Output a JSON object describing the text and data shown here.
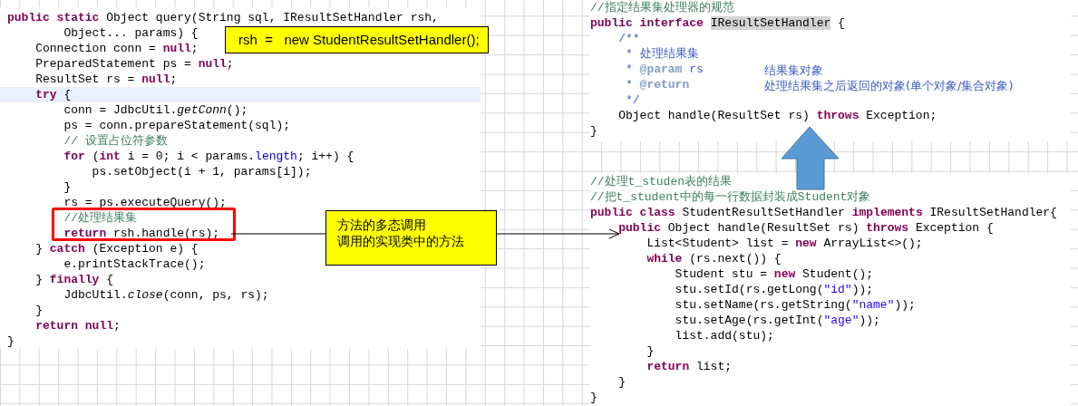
{
  "code_panels": [
    {
      "lines": [
        {
          "current": false,
          "tokens": [
            {
              "kind": "kw",
              "text": "public static"
            },
            {
              "kind": "plain",
              "text": " Object query(String sql, IResultSetHandler rsh,"
            }
          ]
        },
        {
          "current": false,
          "tokens": [
            {
              "kind": "plain",
              "text": "        Object... params) {"
            }
          ]
        },
        {
          "current": false,
          "tokens": [
            {
              "kind": "plain",
              "text": "    Connection conn = "
            },
            {
              "kind": "kw",
              "text": "null"
            },
            {
              "kind": "plain",
              "text": ";"
            }
          ]
        },
        {
          "current": false,
          "tokens": [
            {
              "kind": "plain",
              "text": "    PreparedStatement ps = "
            },
            {
              "kind": "kw",
              "text": "null"
            },
            {
              "kind": "plain",
              "text": ";"
            }
          ]
        },
        {
          "current": false,
          "tokens": [
            {
              "kind": "plain",
              "text": "    ResultSet rs = "
            },
            {
              "kind": "kw",
              "text": "null"
            },
            {
              "kind": "plain",
              "text": ";"
            }
          ]
        },
        {
          "current": true,
          "tokens": [
            {
              "kind": "kw",
              "text": "    try"
            },
            {
              "kind": "plain",
              "text": " {"
            }
          ]
        },
        {
          "current": false,
          "tokens": [
            {
              "kind": "plain",
              "text": "        conn = JdbcUtil."
            },
            {
              "kind": "ital",
              "text": "getConn"
            },
            {
              "kind": "plain",
              "text": "();"
            }
          ]
        },
        {
          "current": false,
          "tokens": [
            {
              "kind": "plain",
              "text": "        ps = conn.prepareStatement(sql);"
            }
          ]
        },
        {
          "current": false,
          "tokens": [
            {
              "kind": "cmt",
              "text": "        // 设置占位符参数"
            }
          ]
        },
        {
          "current": false,
          "tokens": [
            {
              "kind": "kw",
              "text": "        for"
            },
            {
              "kind": "plain",
              "text": " ("
            },
            {
              "kind": "kw",
              "text": "int"
            },
            {
              "kind": "plain",
              "text": " i = 0; i < params."
            },
            {
              "kind": "field",
              "text": "length"
            },
            {
              "kind": "plain",
              "text": "; i++) {"
            }
          ]
        },
        {
          "current": false,
          "tokens": [
            {
              "kind": "plain",
              "text": "            ps.setObject(i + 1, params[i]);"
            }
          ]
        },
        {
          "current": false,
          "tokens": [
            {
              "kind": "plain",
              "text": "        }"
            }
          ]
        },
        {
          "current": false,
          "tokens": [
            {
              "kind": "plain",
              "text": "        rs = ps.executeQuery();"
            }
          ]
        },
        {
          "current": false,
          "tokens": [
            {
              "kind": "cmt",
              "text": "        //处理结果集"
            }
          ]
        },
        {
          "current": false,
          "tokens": [
            {
              "kind": "kw",
              "text": "        return"
            },
            {
              "kind": "plain",
              "text": " rsh.handle(rs);"
            }
          ]
        },
        {
          "current": false,
          "tokens": [
            {
              "kind": "plain",
              "text": "    } "
            },
            {
              "kind": "kw",
              "text": "catch"
            },
            {
              "kind": "plain",
              "text": " (Exception e) {"
            }
          ]
        },
        {
          "current": false,
          "tokens": [
            {
              "kind": "plain",
              "text": "        e.printStackTrace();"
            }
          ]
        },
        {
          "current": false,
          "tokens": [
            {
              "kind": "plain",
              "text": "    } "
            },
            {
              "kind": "kw",
              "text": "finally"
            },
            {
              "kind": "plain",
              "text": " {"
            }
          ]
        },
        {
          "current": false,
          "tokens": [
            {
              "kind": "plain",
              "text": "        JdbcUtil."
            },
            {
              "kind": "ital",
              "text": "close"
            },
            {
              "kind": "plain",
              "text": "(conn, ps, rs);"
            }
          ]
        },
        {
          "current": false,
          "tokens": [
            {
              "kind": "plain",
              "text": "    }"
            }
          ]
        },
        {
          "current": false,
          "tokens": [
            {
              "kind": "kw",
              "text": "    return null"
            },
            {
              "kind": "plain",
              "text": ";"
            }
          ]
        },
        {
          "current": false,
          "tokens": [
            {
              "kind": "plain",
              "text": "}"
            }
          ]
        }
      ]
    },
    {
      "lines": [
        {
          "current": false,
          "tokens": [
            {
              "kind": "cmt",
              "text": "//指定结果集处理器的规范"
            }
          ]
        },
        {
          "current": false,
          "tokens": [
            {
              "kind": "kw",
              "text": "public interface "
            },
            {
              "kind": "hl",
              "text": "IResultSetHandler"
            },
            {
              "kind": "plain",
              "text": " {"
            }
          ]
        },
        {
          "current": false,
          "tokens": [
            {
              "kind": "doc",
              "text": "    /**"
            }
          ]
        },
        {
          "current": false,
          "tokens": [
            {
              "kind": "doc",
              "text": "     * 处理结果集"
            }
          ]
        },
        {
          "current": false,
          "tokens": [
            {
              "kind": "doc",
              "text": "     * "
            },
            {
              "kind": "tag",
              "text": "@param"
            },
            {
              "kind": "doc",
              "text": " rs"
            }
          ]
        },
        {
          "current": false,
          "tokens": [
            {
              "kind": "doc",
              "text": "     * "
            },
            {
              "kind": "tag",
              "text": "@return"
            }
          ]
        },
        {
          "current": false,
          "tokens": [
            {
              "kind": "doc",
              "text": "     */"
            }
          ]
        },
        {
          "current": false,
          "tokens": [
            {
              "kind": "plain",
              "text": "    Object handle(ResultSet rs) "
            },
            {
              "kind": "kw",
              "text": "throws"
            },
            {
              "kind": "plain",
              "text": " Exception;"
            }
          ]
        },
        {
          "current": false,
          "tokens": [
            {
              "kind": "plain",
              "text": "}"
            }
          ]
        }
      ],
      "doc_notes": [
        "结果集对象",
        "处理结果集之后返回的对象(单个对象/集合对象)"
      ]
    },
    {
      "lines": [
        {
          "current": false,
          "tokens": [
            {
              "kind": "cmt",
              "text": "//处理t_studen表的结果"
            }
          ]
        },
        {
          "current": false,
          "tokens": [
            {
              "kind": "cmt",
              "text": "//把t_student中的每一行数据封装成Student对象"
            }
          ]
        },
        {
          "current": false,
          "tokens": [
            {
              "kind": "kw",
              "text": "public class"
            },
            {
              "kind": "plain",
              "text": " StudentResultSetHandler "
            },
            {
              "kind": "kw",
              "text": "implements"
            },
            {
              "kind": "plain",
              "text": " IResultSetHandler{"
            }
          ]
        },
        {
          "current": false,
          "tokens": [
            {
              "kind": "kw",
              "text": "    public"
            },
            {
              "kind": "plain",
              "text": " Object handle(ResultSet rs) "
            },
            {
              "kind": "kw",
              "text": "throws"
            },
            {
              "kind": "plain",
              "text": " Exception {"
            }
          ]
        },
        {
          "current": false,
          "tokens": [
            {
              "kind": "plain",
              "text": "        List<Student> list = "
            },
            {
              "kind": "kw",
              "text": "new"
            },
            {
              "kind": "plain",
              "text": " ArrayList<>();"
            }
          ]
        },
        {
          "current": false,
          "tokens": [
            {
              "kind": "kw",
              "text": "        while"
            },
            {
              "kind": "plain",
              "text": " (rs.next()) {"
            }
          ]
        },
        {
          "current": false,
          "tokens": [
            {
              "kind": "plain",
              "text": "            Student stu = "
            },
            {
              "kind": "kw",
              "text": "new"
            },
            {
              "kind": "plain",
              "text": " Student();"
            }
          ]
        },
        {
          "current": false,
          "tokens": [
            {
              "kind": "plain",
              "text": "            stu.setId(rs.getLong("
            },
            {
              "kind": "str",
              "text": "\"id\""
            },
            {
              "kind": "plain",
              "text": "));"
            }
          ]
        },
        {
          "current": false,
          "tokens": [
            {
              "kind": "plain",
              "text": "            stu.setName(rs.getString("
            },
            {
              "kind": "str",
              "text": "\"name\""
            },
            {
              "kind": "plain",
              "text": "));"
            }
          ]
        },
        {
          "current": false,
          "tokens": [
            {
              "kind": "plain",
              "text": "            stu.setAge(rs.getInt("
            },
            {
              "kind": "str",
              "text": "\"age\""
            },
            {
              "kind": "plain",
              "text": "));"
            }
          ]
        },
        {
          "current": false,
          "tokens": [
            {
              "kind": "plain",
              "text": "            list.add(stu);"
            }
          ]
        },
        {
          "current": false,
          "tokens": [
            {
              "kind": "plain",
              "text": "        }"
            }
          ]
        },
        {
          "current": false,
          "tokens": [
            {
              "kind": "kw",
              "text": "        return"
            },
            {
              "kind": "plain",
              "text": " list;"
            }
          ]
        },
        {
          "current": false,
          "tokens": [
            {
              "kind": "plain",
              "text": "    }"
            }
          ]
        },
        {
          "current": false,
          "tokens": [
            {
              "kind": "plain",
              "text": "}"
            }
          ]
        }
      ]
    }
  ],
  "callouts": [
    {
      "lines": [
        "rsh  =   new StudentResultSetHandler();"
      ]
    },
    {
      "lines": [
        "方法的多态调用",
        "调用的实现类中的方法"
      ]
    }
  ]
}
